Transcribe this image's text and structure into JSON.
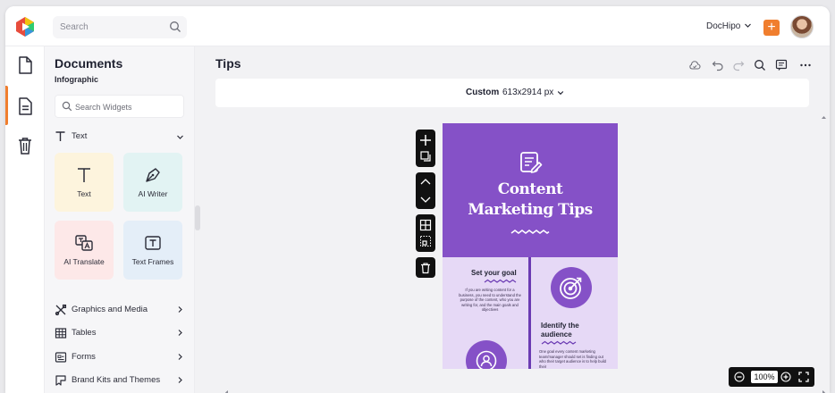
{
  "app": {
    "search_placeholder": "Search",
    "brand_label": "DocHipo",
    "add_label": "+"
  },
  "panel": {
    "title": "Documents",
    "subtitle": "Infographic",
    "search_placeholder": "Search Widgets",
    "text_section": "Text",
    "tiles": [
      {
        "label": "Text"
      },
      {
        "label": "AI Writer"
      },
      {
        "label": "AI Translate"
      },
      {
        "label": "Text Frames"
      }
    ],
    "rows": [
      {
        "label": "Graphics and Media"
      },
      {
        "label": "Tables"
      },
      {
        "label": "Forms"
      },
      {
        "label": "Brand Kits and Themes"
      }
    ]
  },
  "editor": {
    "doc_title": "Tips",
    "size_name": "Custom",
    "size_value": "613x2914 px",
    "zoom": "100%"
  },
  "page": {
    "title_line1": "Content",
    "title_line2": "Marketing Tips",
    "left_heading": "Set your goal",
    "left_body": "If you are writing content for a business, you need to understand the purpose of the content, who you are writing for, and the main goals and objectives",
    "right_heading_1": "Identify the",
    "right_heading_2": "audience",
    "right_body": "One goal every content marketing team/manager should set is finding out who their target audience is to help build their"
  },
  "colors": {
    "accent": "#f07e2e",
    "purple": "#8551c7",
    "purple_light": "#e6d9f6"
  }
}
